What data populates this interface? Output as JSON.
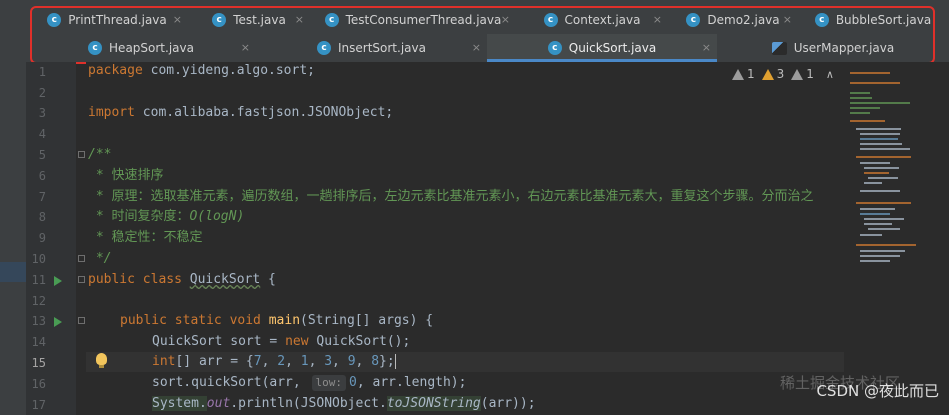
{
  "tabs_row1": [
    {
      "label": "PrintThread.java",
      "icon": "java-class-icon"
    },
    {
      "label": "Test.java",
      "icon": "java-class-icon"
    },
    {
      "label": "TestConsumerThread.java",
      "icon": "java-class-icon"
    },
    {
      "label": "Context.java",
      "icon": "java-class-icon"
    },
    {
      "label": "Demo2.java",
      "icon": "java-class-icon"
    },
    {
      "label": "BubbleSort.java",
      "icon": "java-class-icon"
    }
  ],
  "tabs_row2": [
    {
      "label": "HeapSort.java",
      "icon": "java-class-icon"
    },
    {
      "label": "InsertSort.java",
      "icon": "java-class-icon"
    },
    {
      "label": "QuickSort.java",
      "icon": "java-class-icon",
      "active": true
    },
    {
      "label": "UserMapper.java",
      "icon": "xml-mapper-icon"
    }
  ],
  "close_glyph": "×",
  "class_glyph": "c",
  "inspections": {
    "weak_warnings": "1",
    "warnings": "3",
    "typos": "1"
  },
  "line_numbers": [
    "1",
    "2",
    "3",
    "4",
    "5",
    "6",
    "7",
    "8",
    "9",
    "10",
    "11",
    "12",
    "13",
    "14",
    "15",
    "16",
    "17"
  ],
  "code": {
    "l1_kw": "package",
    "l1_rest": " com.yideng.algo.sort;",
    "l3_kw": "import",
    "l3_rest": " com.alibaba.fastjson.JSONObject;",
    "l5": "/**",
    "l6": " * 快速排序",
    "l7": " * 原理：选取基准元素，遍历数组，一趟排序后，左边元素比基准元素小，右边元素比基准元素大，重复这个步骤。分而治之",
    "l8_a": " * 时间复杂度：",
    "l8_b": "O(logN)",
    "l9": " * 稳定性：不稳定",
    "l10": " */",
    "l11_kw": "public class ",
    "l11_name": "QuickSort",
    "l11_end": " {",
    "l13_kw": "public static void ",
    "l13_fn": "main",
    "l13_rest": "(String[] args) {",
    "l14_a": "QuickSort sort = ",
    "l14_kw": "new",
    "l14_b": " QuickSort();",
    "l15_kw": "int",
    "l15_a": "[] arr = {",
    "n1": "7",
    ", ": ", ",
    "n2": "2",
    "n3": "1",
    "n4": "3",
    "n5": "9",
    "n6": "8",
    "l15_end": "};",
    "l16_a": "sort.quickSort(arr, ",
    "l16_hint": "low:",
    "n0": "0",
    "l16_b": ", arr.length);",
    "l17_a": "System.",
    "l17_out": "out",
    "l17_b": ".println(JSONObject.",
    "l17_fn": "toJSONString",
    "l17_c": "(arr));"
  },
  "watermark_main": "CSDN @夜此而已",
  "watermark_faint": "稀土掘金技术社区",
  "colors": {
    "accent": "#4a88c7",
    "highlight_box": "#e0302a",
    "keyword": "#cc7832",
    "number": "#6897bb",
    "doc": "#629755"
  }
}
